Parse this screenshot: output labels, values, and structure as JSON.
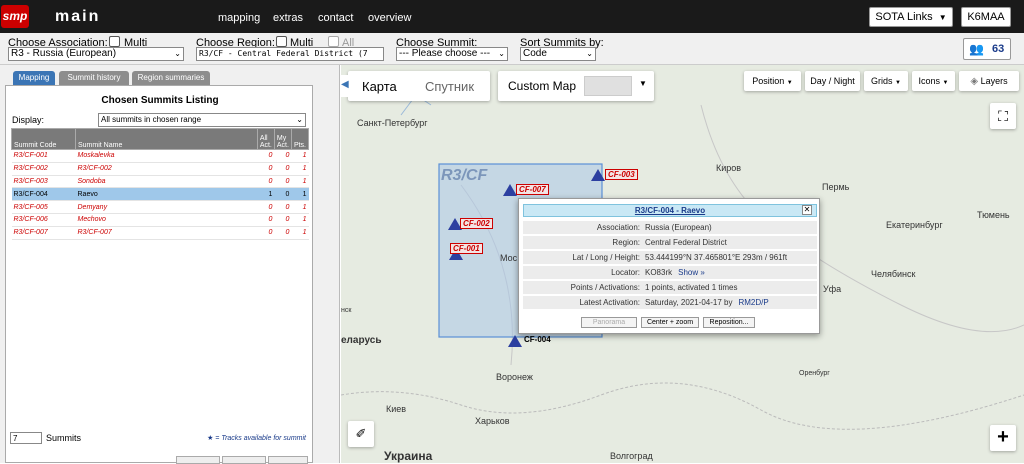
{
  "app": {
    "logo_text": "smp",
    "title": "main"
  },
  "nav": {
    "items": [
      "mapping",
      "extras",
      "contact",
      "overview"
    ]
  },
  "header_right": {
    "sota_links": "SOTA Links",
    "callsign": "K6MAA",
    "activator_count": "63"
  },
  "filters": {
    "assoc_label": "Choose Association:",
    "assoc_multi": "Multi",
    "assoc_value": "R3 - Russia (European)",
    "region_label": "Choose Region:",
    "region_multi": "Multi",
    "region_all": "All",
    "region_value": "R3/CF - Central Federal District (7",
    "summit_label": "Choose Summit:",
    "summit_value": "--- Please choose ---",
    "sort_label": "Sort Summits by:",
    "sort_value": "Code"
  },
  "left": {
    "tabs": [
      "Mapping",
      "Summit history",
      "Region summaries"
    ],
    "listing_title": "Chosen Summits Listing",
    "display_label": "Display:",
    "display_value": "All summits in chosen range",
    "columns": {
      "code": "Summit Code",
      "name": "Summit Name",
      "all": "All Act.",
      "my": "My Act.",
      "pts": "Pts."
    },
    "rows": [
      {
        "code": "R3/CF-001",
        "name": "Moskalevka",
        "all": "0",
        "my": "0",
        "pts": "1"
      },
      {
        "code": "R3/CF-002",
        "name": "R3/CF-002",
        "all": "0",
        "my": "0",
        "pts": "1"
      },
      {
        "code": "R3/CF-003",
        "name": "Sondoba",
        "all": "0",
        "my": "0",
        "pts": "1"
      },
      {
        "code": "R3/CF-004",
        "name": "Raevo",
        "all": "1",
        "my": "0",
        "pts": "1"
      },
      {
        "code": "R3/CF-005",
        "name": "Demyany",
        "all": "0",
        "my": "0",
        "pts": "1"
      },
      {
        "code": "R3/CF-006",
        "name": "Mechovo",
        "all": "0",
        "my": "0",
        "pts": "1"
      },
      {
        "code": "R3/CF-007",
        "name": "R3/CF-007",
        "all": "0",
        "my": "0",
        "pts": "1"
      }
    ],
    "count": "7",
    "count_label": "Summits",
    "tracks_note": "★ = Tracks available for summit"
  },
  "map": {
    "map_type_map": "Карта",
    "map_type_sat": "Спутник",
    "custom_map": "Custom Map",
    "controls": [
      "Position",
      "Day / Night",
      "Grids",
      "Icons",
      "Layers"
    ],
    "region_label": "R3/CF",
    "cities": [
      {
        "name": "Санкт-Петербург"
      },
      {
        "name": "Киров"
      },
      {
        "name": "Пермь"
      },
      {
        "name": "Тюмень"
      },
      {
        "name": "Екатеринбург"
      },
      {
        "name": "Челябинск"
      },
      {
        "name": "Уфа"
      },
      {
        "name": "Оренбург"
      },
      {
        "name": "Воронеж"
      },
      {
        "name": "Харьков"
      },
      {
        "name": "Киев"
      },
      {
        "name": "Волгоград"
      },
      {
        "name": "Украина"
      },
      {
        "name": "еларусь"
      },
      {
        "name": "Мос"
      },
      {
        "name": "нск"
      }
    ],
    "markers": [
      "CF-001",
      "CF-002",
      "CF-003",
      "CF-004",
      "CF-007"
    ]
  },
  "popup": {
    "title": "R3/CF-004 - Raevo",
    "rows": [
      {
        "k": "Association:",
        "v": "Russia (European)"
      },
      {
        "k": "Region:",
        "v": "Central Federal District"
      },
      {
        "k": "Lat / Long / Height:",
        "v": "53.444199°N     37.465801°E     293m / 961ft"
      },
      {
        "k": "Locator:",
        "v": "KO83rk",
        "link": "Show »"
      },
      {
        "k": "Points / Activations:",
        "v": "1 points,  activated 1 times"
      },
      {
        "k": "Latest Activation:",
        "v": "Saturday, 2021-04-17 by",
        "link": "RM2D/P"
      }
    ],
    "buttons": [
      "Panorama",
      "Center + zoom",
      "Reposition..."
    ]
  },
  "colors": {
    "topbar": "#1a1a1a",
    "selected_row": "#9fc8ea",
    "summit_red": "#cc0000",
    "tab_active": "#3b75b5",
    "tab_inactive": "#8d8d8d",
    "region_fill": "#aac6e8"
  }
}
